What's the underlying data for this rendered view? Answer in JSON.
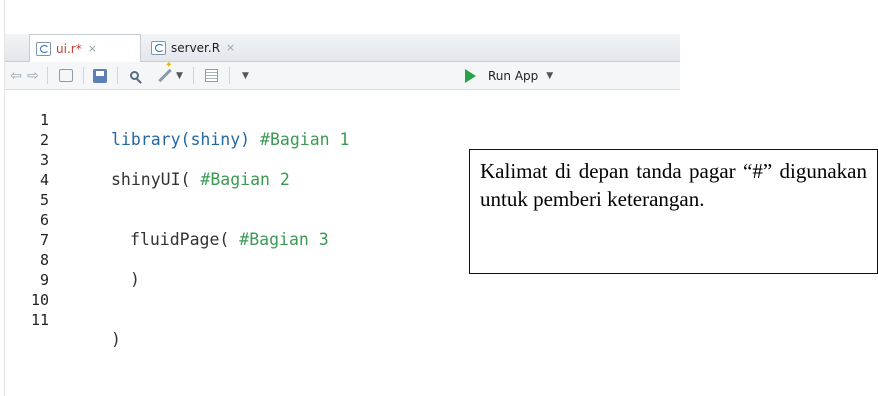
{
  "tabs": [
    {
      "name": "ui.r",
      "modified_mark": "*",
      "close": "×"
    },
    {
      "name": "server.R",
      "close": "×"
    }
  ],
  "toolbar": {
    "run_label": "Run App"
  },
  "code_lines": [
    {
      "num": "1",
      "parts": [
        "library",
        "(shiny) ",
        "#Bagian 1"
      ]
    },
    {
      "num": "2"
    },
    {
      "num": "3",
      "parts": [
        "shinyUI",
        "( ",
        "#Bagian 2"
      ]
    },
    {
      "num": "4"
    },
    {
      "num": "5"
    },
    {
      "num": "6",
      "parts": [
        "fluidPage",
        "( ",
        "#Bagian 3"
      ]
    },
    {
      "num": "7"
    },
    {
      "num": "8",
      "parts": [
        ")"
      ]
    },
    {
      "num": "9"
    },
    {
      "num": "10"
    },
    {
      "num": "11",
      "parts": [
        ")"
      ]
    }
  ],
  "note": "Kalimat di depan tanda pagar “#” digunakan untuk pemberi keterangan.",
  "colors": {
    "keyword": "#2468a6",
    "comment": "#3a9b53",
    "run_icon": "#27a347"
  },
  "icons": [
    "back-arrow-icon",
    "forward-arrow-icon",
    "go-to-file-icon",
    "save-icon",
    "search-icon",
    "magic-wand-icon",
    "compile-report-icon",
    "run-app-icon"
  ]
}
